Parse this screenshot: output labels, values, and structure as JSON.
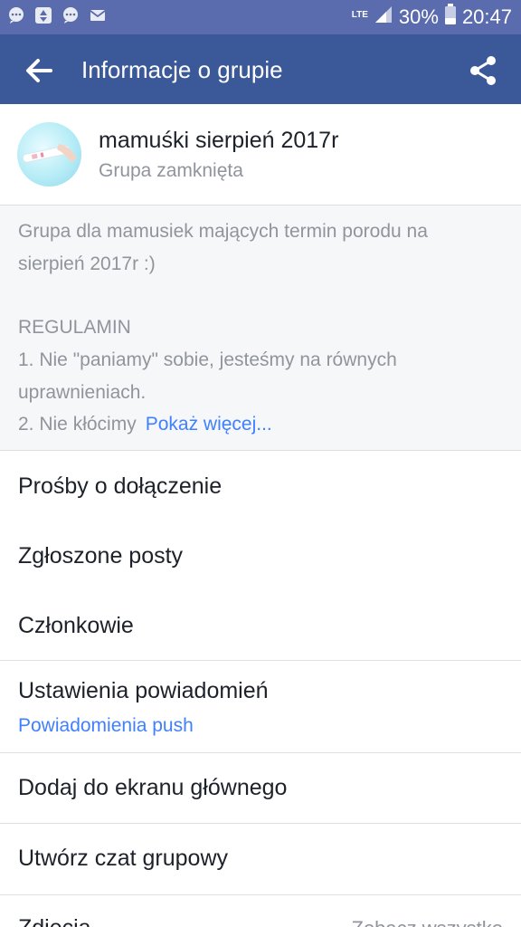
{
  "status_bar": {
    "network": "LTE",
    "battery": "30%",
    "time": "20:47",
    "left_icons": [
      "chat-bubble-icon",
      "recycle-icon",
      "chat-bubble-icon",
      "mail-icon"
    ]
  },
  "app_bar": {
    "title": "Informacje o grupie",
    "back_icon": "arrow-left-icon",
    "share_icon": "share-icon"
  },
  "group": {
    "name": "mamuśki sierpień 2017r",
    "type": "Grupa zamknięta"
  },
  "description": {
    "line1": "Grupa dla mamusiek mających termin porodu na",
    "line2": "sierpień  2017r :)",
    "rules_heading": "REGULAMIN",
    "rule1a": "1. Nie \"paniamy\" sobie, jesteśmy na równych",
    "rule1b": "uprawnieniach.",
    "rule2": "2. Nie kłócimy",
    "show_more": "Pokaż więcej..."
  },
  "menu": {
    "join_requests": "Prośby o dołączenie",
    "reported_posts": "Zgłoszone posty",
    "members": "Członkowie",
    "notification_settings": "Ustawienia powiadomień",
    "notification_settings_sub": "Powiadomienia push",
    "add_to_home": "Dodaj do ekranu głównego",
    "create_group_chat": "Utwórz czat grupowy",
    "photos": "Zdjęcia",
    "see_all": "Zobacz wszystko"
  },
  "colors": {
    "status_bar": "#5a6cad",
    "app_bar": "#3b5998",
    "link": "#4080ff",
    "secondary_text": "#90949c"
  }
}
